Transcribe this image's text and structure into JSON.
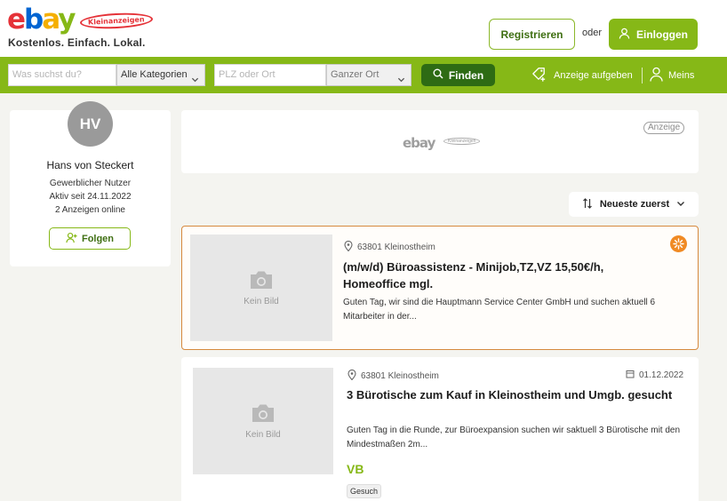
{
  "header": {
    "logo_text": "ebay",
    "logo_badge": "Kleinanzeigen",
    "tagline": "Kostenlos. Einfach. Lokal.",
    "register_label": "Registrieren",
    "or_label": "oder",
    "login_label": "Einloggen"
  },
  "search": {
    "query_placeholder": "Was suchst du?",
    "category_value": "Alle Kategorien",
    "location_placeholder": "PLZ oder Ort",
    "radius_value": "Ganzer Ort",
    "find_label": "Finden",
    "post_ad_label": "Anzeige aufgeben",
    "mine_label": "Meins"
  },
  "profile": {
    "initials": "HV",
    "name": "Hans von Steckert",
    "user_type": "Gewerblicher Nutzer",
    "active_since": "Aktiv seit 24.11.2022",
    "ads_online": "2 Anzeigen online",
    "follow_label": "Folgen"
  },
  "ad_banner": {
    "logo_text": "ebay",
    "label": "Anzeige"
  },
  "sort": {
    "label": "Neueste zuerst"
  },
  "listings": [
    {
      "image_placeholder": "Kein Bild",
      "location": "63801 Kleinostheim",
      "date": "",
      "title": "(m/w/d) Büroassistenz - Minijob,TZ,VZ 15,50€/h, Homeoffice mgl.",
      "description": "Guten Tag, wir sind die Hauptmann Service Center GmbH und suchen aktuell 6 Mitarbeiter in der...",
      "price": "",
      "tag": ""
    },
    {
      "image_placeholder": "Kein Bild",
      "location": "63801 Kleinostheim",
      "date": "01.12.2022",
      "title": "3 Bürotische zum Kauf in Kleinostheim und Umgb. gesucht",
      "description": "Guten Tag in die Runde, zur Büroexpansion suchen wir saktuell 3 Bürotische mit den Mindestmaßen 2m...",
      "price": "VB",
      "tag": "Gesuch"
    }
  ],
  "colors": {
    "brand_green": "#86b817",
    "dark_green": "#2e6b14",
    "highlight_orange": "#d6893d"
  }
}
